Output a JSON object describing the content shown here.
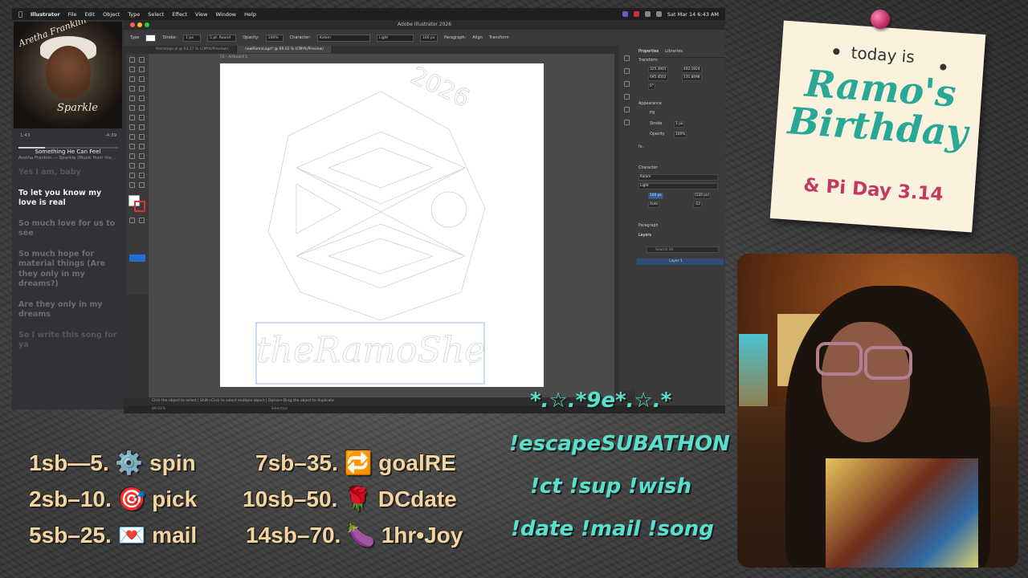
{
  "menubar": {
    "app": "Illustrator",
    "items": [
      "File",
      "Edit",
      "Object",
      "Type",
      "Select",
      "Effect",
      "View",
      "Window",
      "Help"
    ],
    "clock": "Sat Mar 14  6:43 AM"
  },
  "music": {
    "album_artist_text": "Aretha Franklin",
    "album_title_text": "Sparkle",
    "elapsed": "1:43",
    "remaining": "-4:39",
    "progress": 0.27,
    "song_title": "Something He Can Feel",
    "song_artist": "Aretha Franklin — Sparkle (Music from the...",
    "lyrics": [
      {
        "text": "Yes I am, baby",
        "state": "past"
      },
      {
        "text": "To let you know my love is real",
        "state": "active"
      },
      {
        "text": "So much love for us to see",
        "state": "next"
      },
      {
        "text": "So much hope for material things (Are they only in my dreams?)",
        "state": "next"
      },
      {
        "text": "Are they only in my dreams",
        "state": "next"
      },
      {
        "text": "So I write this song for ya",
        "state": "faint"
      }
    ]
  },
  "illustrator": {
    "window_title": "Adobe Illustrator 2026",
    "control": {
      "label_type": "Type",
      "stroke_label": "Stroke:",
      "stroke_value": "1 px",
      "brush": "5 pt. Round",
      "opacity_label": "Opacity:",
      "opacity_value": "100%",
      "character_label": "Character:",
      "font": "Kalam",
      "weight": "Light",
      "size": "100 px",
      "paragraph_label": "Paragraph:",
      "align_label": "Align",
      "transform_label": "Transform"
    },
    "tabs": [
      {
        "label": "ltocinlogo.ai @ 83.27 % (CMYK/Preview)",
        "active": false
      },
      {
        "label": "newRamoLogo* @ 89.01 % (CMYK/Preview)",
        "active": true
      }
    ],
    "artboard_label": "01 - Artboard 1",
    "artwork": {
      "year": "2026",
      "wordmark": "theRamoShe"
    },
    "status_hint": "Click the object to select  |  Shift+Click to select multiple object  |  Option+Drag the object to duplicate",
    "zoom": "89.01%",
    "status_mode": "Selection",
    "properties": {
      "tabs": [
        "Properties",
        "Libraries"
      ],
      "transform_label": "Transform",
      "x": "325.3901",
      "y": "695.4502",
      "w": "492.1924",
      "h": "131.8498",
      "angle": "0°",
      "appearance_label": "Appearance",
      "fill_label": "Fill",
      "stroke_label": "Stroke",
      "stroke_value": "1 px",
      "opacity_label": "Opacity",
      "opacity_value": "100%",
      "fx_label": "fx.",
      "character_label": "Character",
      "font": "Kalam",
      "weight": "Light",
      "size": "100 px",
      "leading": "(120 px)",
      "tracking": "Auto",
      "kerning": "-12",
      "paragraph_label": "Paragraph",
      "layers_label": "Layers",
      "search_placeholder": "Search All",
      "layer_name": "Layer 1"
    }
  },
  "note": {
    "today": "today is",
    "name_line1": "Ramo's",
    "name_line2": "Birthday",
    "pi": "& Pi Day 3.14"
  },
  "overlay": {
    "subs_left": [
      "1sb—5. ⚙️ spin",
      "2sb–10. 🎯 pick",
      "5sb–25. 💌 mail"
    ],
    "subs_right": [
      "7sb–35. 🔁 goalRE",
      "10sb–50. 🌹 DCdate",
      "14sb–70. 🍆 1hr•Joy"
    ],
    "commands": [
      "*.☆.*9e*.☆.*",
      "!escapeSUBATHON",
      "!ct !sup !wish",
      "!date !mail !song"
    ]
  },
  "colors": {
    "note_teal": "#2aa897",
    "note_pink": "#c23a63",
    "sub_text": "#f5d59f",
    "cmd_text": "#59e0cd"
  }
}
